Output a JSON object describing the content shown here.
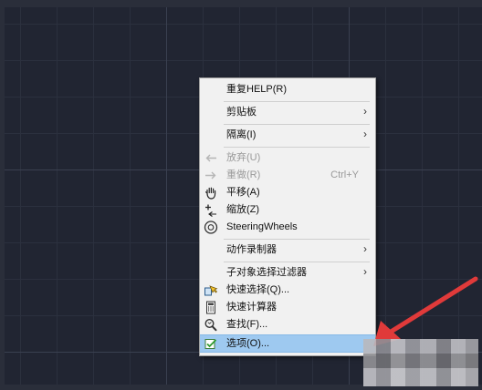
{
  "context_menu": {
    "items": [
      {
        "label": "重复HELP(R)"
      },
      {
        "label": "剪贴板",
        "submenu_arrow": "›"
      },
      {
        "label": "隔离(I)",
        "submenu_arrow": "›"
      },
      {
        "label": "放弃(U)",
        "disabled": true
      },
      {
        "label": "重做(R)",
        "shortcut": "Ctrl+Y",
        "disabled": true
      },
      {
        "label": "平移(A)"
      },
      {
        "label": "缩放(Z)"
      },
      {
        "label": "SteeringWheels"
      },
      {
        "label": "动作录制器",
        "submenu_arrow": "›"
      },
      {
        "label": "子对象选择过滤器",
        "submenu_arrow": "›"
      },
      {
        "label": "快速选择(Q)..."
      },
      {
        "label": "快速计算器"
      },
      {
        "label": "查找(F)..."
      },
      {
        "label": "选项(O)...",
        "highlighted": true
      }
    ]
  },
  "colors": {
    "canvas_background": "#212532",
    "menu_background": "#f1f1f1",
    "highlight": "#9ec9f0",
    "annotation_arrow": "#e03a3a"
  },
  "icons": {
    "undo": "undo-arrow-icon",
    "redo": "redo-arrow-icon",
    "pan": "hand-pan-icon",
    "zoom": "zoom-icon",
    "steering": "steering-wheels-icon",
    "quick_select": "quick-select-icon",
    "calculator": "calculator-icon",
    "find": "find-magnifier-icon",
    "options": "options-checkbox-icon"
  }
}
